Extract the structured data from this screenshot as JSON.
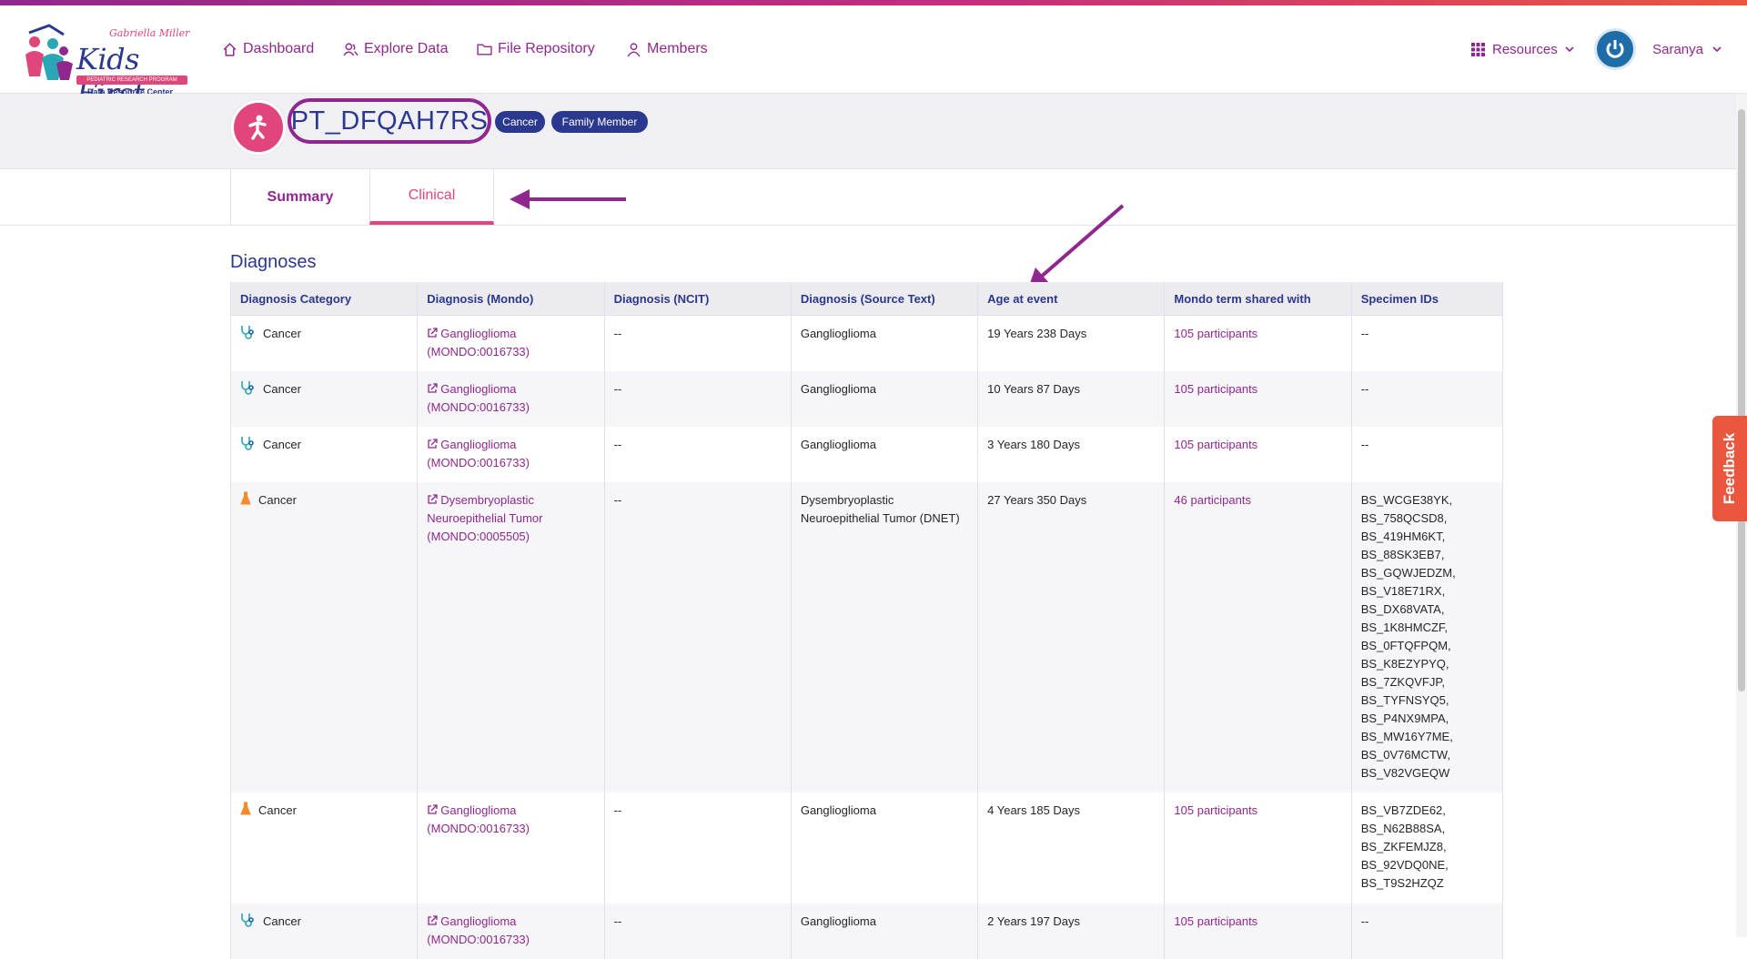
{
  "brand": {
    "logo_main": "Kids First",
    "logo_top": "Gabriella Miller",
    "logo_band": "PEDIATRIC RESEARCH PROGRAM",
    "logo_sub": "Data Resource Center"
  },
  "nav": [
    {
      "label": "Dashboard",
      "icon": "home-icon"
    },
    {
      "label": "Explore Data",
      "icon": "users-icon"
    },
    {
      "label": "File Repository",
      "icon": "folder-icon"
    },
    {
      "label": "Members",
      "icon": "user-icon"
    }
  ],
  "header_right": {
    "resources_label": "Resources",
    "user_name": "Saranya"
  },
  "entity": {
    "id": "PT_DFQAH7RS",
    "tags": [
      "Cancer",
      "Family Member"
    ]
  },
  "tabs": [
    {
      "label": "Summary",
      "active": false
    },
    {
      "label": "Clinical",
      "active": true
    }
  ],
  "section_title": "Diagnoses",
  "table": {
    "columns": [
      "Diagnosis Category",
      "Diagnosis (Mondo)",
      "Diagnosis (NCIT)",
      "Diagnosis (Source Text)",
      "Age at event",
      "Mondo term shared with",
      "Specimen IDs"
    ],
    "rows": [
      {
        "category": "Cancer",
        "icon": "stethoscope-icon",
        "mondo": "Ganglioglioma (MONDO:0016733)",
        "ncit": "--",
        "source": "Ganglioglioma",
        "age": "19 Years 238 Days",
        "shared": "105 participants",
        "specimens": "--"
      },
      {
        "category": "Cancer",
        "icon": "stethoscope-icon",
        "mondo": "Ganglioglioma (MONDO:0016733)",
        "ncit": "--",
        "source": "Ganglioglioma",
        "age": "10 Years 87 Days",
        "shared": "105 participants",
        "specimens": "--"
      },
      {
        "category": "Cancer",
        "icon": "stethoscope-icon",
        "mondo": "Ganglioglioma (MONDO:0016733)",
        "ncit": "--",
        "source": "Ganglioglioma",
        "age": "3 Years 180 Days",
        "shared": "105 participants",
        "specimens": "--"
      },
      {
        "category": "Cancer",
        "icon": "flask-icon",
        "mondo": "Dysembryoplastic Neuroepithelial Tumor (MONDO:0005505)",
        "ncit": "--",
        "source": "Dysembryoplastic Neuroepithelial Tumor (DNET)",
        "age": "27 Years 350 Days",
        "shared": "46 participants",
        "specimens": "BS_WCGE38YK, BS_758QCSD8, BS_419HM6KT, BS_88SK3EB7, BS_GQWJEDZM, BS_V18E71RX, BS_DX68VATA, BS_1K8HMCZF, BS_0FTQFPQM, BS_K8EZYPYQ, BS_7ZKQVFJP, BS_TYFNSYQ5, BS_P4NX9MPA, BS_MW16Y7ME, BS_0V76MCTW, BS_V82VGEQW"
      },
      {
        "category": "Cancer",
        "icon": "flask-icon",
        "mondo": "Ganglioglioma (MONDO:0016733)",
        "ncit": "--",
        "source": "Ganglioglioma",
        "age": "4 Years 185 Days",
        "shared": "105 participants",
        "specimens": "BS_VB7ZDE62, BS_N62B88SA, BS_ZKFEMJZ8, BS_92VDQ0NE, BS_T9S2HZQZ"
      },
      {
        "category": "Cancer",
        "icon": "stethoscope-icon",
        "mondo": "Ganglioglioma (MONDO:0016733)",
        "ncit": "--",
        "source": "Ganglioglioma",
        "age": "2 Years 197 Days",
        "shared": "105 participants",
        "specimens": "--"
      }
    ]
  },
  "feedback_label": "Feedback",
  "colors": {
    "primary": "#90278e",
    "accent": "#e0457b",
    "navy": "#2b388f",
    "feedback": "#e9573f"
  }
}
